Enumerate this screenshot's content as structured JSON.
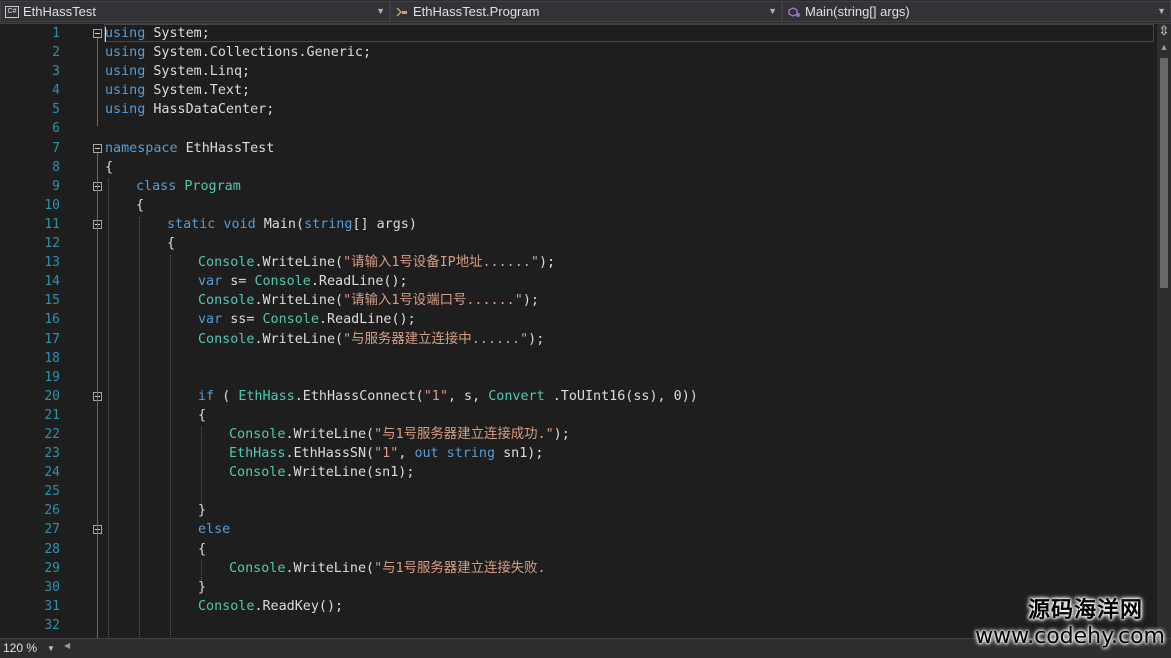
{
  "navbar": {
    "project": "EthHassTest",
    "class": "EthHassTest.Program",
    "member": "Main(string[] args)"
  },
  "icons": [
    "csharp-project-icon",
    "class-icon",
    "method-icon",
    "split-window-icon",
    "chevron-down-icon"
  ],
  "lines": [
    {
      "n": "1",
      "indent": 0,
      "fold": "start",
      "tokens": [
        {
          "k": "kw",
          "t": "using"
        },
        {
          "k": "p",
          "t": " System;"
        }
      ]
    },
    {
      "n": "2",
      "indent": 0,
      "tokens": [
        {
          "k": "kw",
          "t": "using"
        },
        {
          "k": "p",
          "t": " System.Collections.Generic;"
        }
      ]
    },
    {
      "n": "3",
      "indent": 0,
      "tokens": [
        {
          "k": "kw",
          "t": "using"
        },
        {
          "k": "p",
          "t": " System.Linq;"
        }
      ]
    },
    {
      "n": "4",
      "indent": 0,
      "tokens": [
        {
          "k": "kw",
          "t": "using"
        },
        {
          "k": "p",
          "t": " System.Text;"
        }
      ]
    },
    {
      "n": "5",
      "indent": 0,
      "fold": "end",
      "tokens": [
        {
          "k": "kw",
          "t": "using"
        },
        {
          "k": "p",
          "t": " HassDataCenter;"
        }
      ]
    },
    {
      "n": "6",
      "indent": 0,
      "tokens": []
    },
    {
      "n": "7",
      "indent": 0,
      "fold": "start",
      "tokens": [
        {
          "k": "kw",
          "t": "namespace"
        },
        {
          "k": "p",
          "t": " EthHassTest"
        }
      ]
    },
    {
      "n": "8",
      "indent": 0,
      "tokens": [
        {
          "k": "p",
          "t": "{"
        }
      ]
    },
    {
      "n": "9",
      "indent": 4,
      "fold": "start",
      "tokens": [
        {
          "k": "kw",
          "t": "class"
        },
        {
          "k": "p",
          "t": " "
        },
        {
          "k": "ty",
          "t": "Program"
        }
      ]
    },
    {
      "n": "10",
      "indent": 4,
      "tokens": [
        {
          "k": "p",
          "t": "{"
        }
      ]
    },
    {
      "n": "11",
      "indent": 8,
      "fold": "start",
      "tokens": [
        {
          "k": "kw",
          "t": "static void"
        },
        {
          "k": "p",
          "t": " Main("
        },
        {
          "k": "kw",
          "t": "string"
        },
        {
          "k": "p",
          "t": "[] args)"
        }
      ]
    },
    {
      "n": "12",
      "indent": 8,
      "tokens": [
        {
          "k": "p",
          "t": "{"
        }
      ]
    },
    {
      "n": "13",
      "indent": 12,
      "tokens": [
        {
          "k": "ty",
          "t": "Console"
        },
        {
          "k": "p",
          "t": ".WriteLine("
        },
        {
          "k": "st",
          "t": "\"请输入1号设备IP地址......\""
        },
        {
          "k": "p",
          "t": ");"
        }
      ]
    },
    {
      "n": "14",
      "indent": 12,
      "tokens": [
        {
          "k": "kw",
          "t": "var"
        },
        {
          "k": "p",
          "t": " s= "
        },
        {
          "k": "ty",
          "t": "Console"
        },
        {
          "k": "p",
          "t": ".ReadLine();"
        }
      ]
    },
    {
      "n": "15",
      "indent": 12,
      "tokens": [
        {
          "k": "ty",
          "t": "Console"
        },
        {
          "k": "p",
          "t": ".WriteLine("
        },
        {
          "k": "st",
          "t": "\"请输入1号设端口号......\""
        },
        {
          "k": "p",
          "t": ");"
        }
      ]
    },
    {
      "n": "16",
      "indent": 12,
      "tokens": [
        {
          "k": "kw",
          "t": "var"
        },
        {
          "k": "p",
          "t": " ss= "
        },
        {
          "k": "ty",
          "t": "Console"
        },
        {
          "k": "p",
          "t": ".ReadLine();"
        }
      ]
    },
    {
      "n": "17",
      "indent": 12,
      "tokens": [
        {
          "k": "ty",
          "t": "Console"
        },
        {
          "k": "p",
          "t": ".WriteLine("
        },
        {
          "k": "st",
          "t": "\"与服务器建立连接中......\""
        },
        {
          "k": "p",
          "t": ");"
        }
      ]
    },
    {
      "n": "18",
      "indent": 0,
      "tokens": []
    },
    {
      "n": "19",
      "indent": 0,
      "tokens": []
    },
    {
      "n": "20",
      "indent": 12,
      "fold": "start",
      "tokens": [
        {
          "k": "kw",
          "t": "if"
        },
        {
          "k": "p",
          "t": " ( "
        },
        {
          "k": "ty",
          "t": "EthHass"
        },
        {
          "k": "p",
          "t": ".EthHassConnect("
        },
        {
          "k": "st",
          "t": "\"1\""
        },
        {
          "k": "p",
          "t": ", s, "
        },
        {
          "k": "ty",
          "t": "Convert"
        },
        {
          "k": "p",
          "t": " .ToUInt16(ss), 0))"
        }
      ]
    },
    {
      "n": "21",
      "indent": 12,
      "tokens": [
        {
          "k": "p",
          "t": "{"
        }
      ]
    },
    {
      "n": "22",
      "indent": 16,
      "tokens": [
        {
          "k": "ty",
          "t": "Console"
        },
        {
          "k": "p",
          "t": ".WriteLine("
        },
        {
          "k": "st",
          "t": "\"与1号服务器建立连接成功.\""
        },
        {
          "k": "p",
          "t": ");"
        }
      ]
    },
    {
      "n": "23",
      "indent": 16,
      "tokens": [
        {
          "k": "ty",
          "t": "EthHass"
        },
        {
          "k": "p",
          "t": ".EthHassSN("
        },
        {
          "k": "st",
          "t": "\"1\""
        },
        {
          "k": "p",
          "t": ", "
        },
        {
          "k": "kw",
          "t": "out string"
        },
        {
          "k": "p",
          "t": " sn1);"
        }
      ]
    },
    {
      "n": "24",
      "indent": 16,
      "tokens": [
        {
          "k": "ty",
          "t": "Console"
        },
        {
          "k": "p",
          "t": ".WriteLine(sn1);"
        }
      ]
    },
    {
      "n": "25",
      "indent": 0,
      "tokens": []
    },
    {
      "n": "26",
      "indent": 12,
      "tokens": [
        {
          "k": "p",
          "t": "}"
        }
      ]
    },
    {
      "n": "27",
      "indent": 12,
      "fold": "start",
      "tokens": [
        {
          "k": "kw",
          "t": "else"
        }
      ]
    },
    {
      "n": "28",
      "indent": 12,
      "tokens": [
        {
          "k": "p",
          "t": "{"
        }
      ]
    },
    {
      "n": "29",
      "indent": 16,
      "tokens": [
        {
          "k": "ty",
          "t": "Console"
        },
        {
          "k": "p",
          "t": ".WriteLine("
        },
        {
          "k": "st",
          "t": "\"与1号服务器建立连接失败."
        }
      ]
    },
    {
      "n": "30",
      "indent": 12,
      "tokens": [
        {
          "k": "p",
          "t": "}"
        }
      ]
    },
    {
      "n": "31",
      "indent": 12,
      "tokens": [
        {
          "k": "ty",
          "t": "Console"
        },
        {
          "k": "p",
          "t": ".ReadKey();"
        }
      ]
    },
    {
      "n": "32",
      "indent": 0,
      "tokens": []
    }
  ],
  "colors": {
    "keyword": "#569cd6",
    "type": "#4ec9b0",
    "string": "#d69d85",
    "plain": "#dcdcdc",
    "line_number": "#2b91af",
    "background": "#1e1e1e"
  },
  "status": {
    "zoom": "120 %"
  },
  "watermark": {
    "line1": "源码海洋网",
    "line2": "www.codehy.com"
  }
}
